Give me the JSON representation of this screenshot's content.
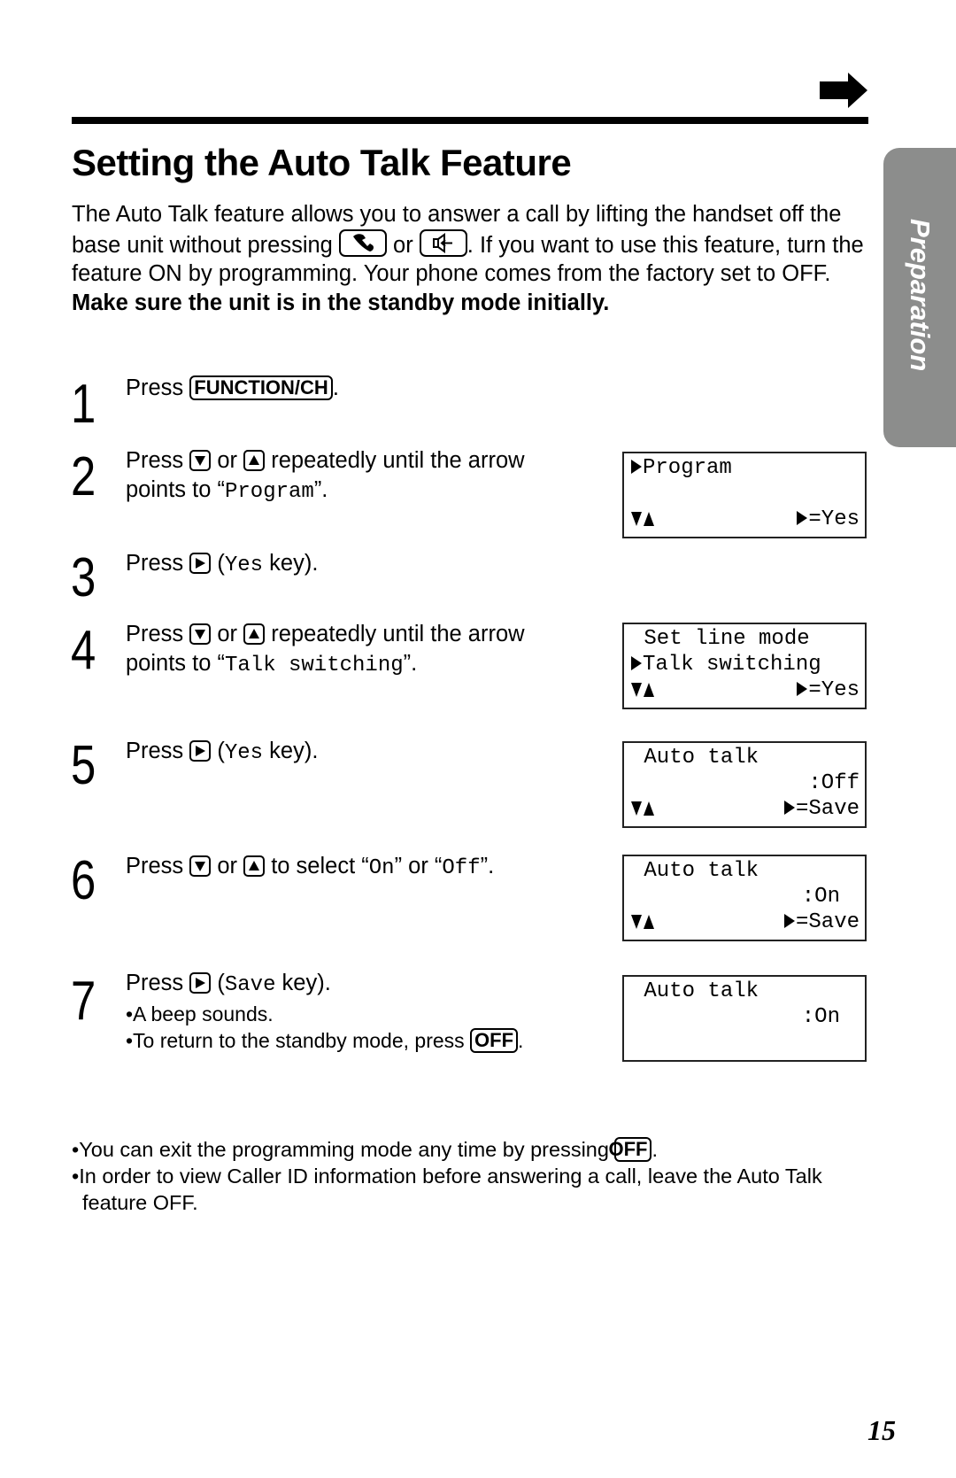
{
  "header": {
    "continue_arrow_icon": "right-arrow-icon",
    "title": "Setting the Auto Talk Feature"
  },
  "side_tab": {
    "label": "Preparation",
    "color": "#8c8d8c"
  },
  "intro": {
    "part1": "The Auto Talk feature allows you to answer a call by lifting the handset off the base unit without pressing ",
    "key1_icon": "talk-handset-icon",
    "or": " or ",
    "key2_icon": "speakerphone-icon",
    "part2": ". If you want to use this feature, turn the feature ON by programming. Your phone comes from the factory set to OFF.",
    "bold_note": "Make sure the unit is in the standby mode initially."
  },
  "steps": [
    {
      "number": "1",
      "press": "Press ",
      "key": "FUNCTION/CH",
      "end": "."
    },
    {
      "number": "2",
      "press": "Press ",
      "or": " or ",
      "text": " repeatedly until the arrow points to “",
      "mono": "Program",
      "end": "”."
    },
    {
      "number": "3",
      "press": "Press ",
      "open": " (",
      "mono": "Yes",
      "end": " key)."
    },
    {
      "number": "4",
      "press": "Press ",
      "or": " or ",
      "text": " repeatedly until the arrow points to “",
      "mono": "Talk switching",
      "end": "”."
    },
    {
      "number": "5",
      "press": "Press ",
      "open": " (",
      "mono": "Yes",
      "end": " key)."
    },
    {
      "number": "6",
      "press": "Press ",
      "or": " or ",
      "text": " to select “",
      "mono1": "On",
      "mid": "” or “",
      "mono2": "Off",
      "end": "”."
    },
    {
      "number": "7",
      "press": "Press ",
      "open": " (",
      "mono": "Save",
      "end": " key).",
      "bullets": [
        "•A beep sounds.",
        "•To return to the standby mode, press "
      ],
      "bullet_key": "OFF",
      "bullet_end": "."
    }
  ],
  "displays": [
    {
      "line1": "Program",
      "line1_pointer": true,
      "line2": "",
      "nav": true,
      "action": "=Yes"
    },
    {
      "line1": " Set line mode",
      "line2": "Talk switching",
      "line2_pointer": true,
      "nav": true,
      "action": "=Yes"
    },
    {
      "line1": " Auto talk",
      "line2": ":Off",
      "nav": true,
      "action": "=Save"
    },
    {
      "line1": " Auto talk",
      "line2": ":On",
      "nav": true,
      "action": "=Save"
    },
    {
      "line1": " Auto talk",
      "line2": ":On"
    }
  ],
  "notes": {
    "note1": "•You can exit the programming mode any time by pressing ",
    "note1_key": "OFF",
    "note1_end": ".",
    "note2": "•In order to view Caller ID information before answering a call, leave the Auto Talk feature OFF."
  },
  "page_number": "15"
}
